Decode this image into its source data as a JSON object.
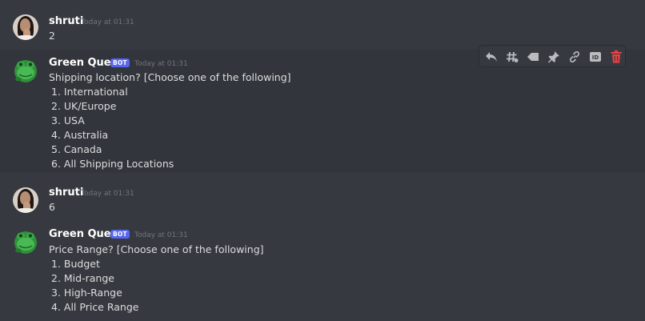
{
  "messages": [
    {
      "username": "shruti",
      "timestamp": "Today at 01:31",
      "lines": [
        "2"
      ]
    },
    {
      "username": "Green Queen",
      "badge": "BOT",
      "timestamp": "Today at 01:31",
      "lines": [
        "Shipping location? [Choose one of the following]",
        "1. International",
        "2. UK/Europe",
        "3. USA",
        "4. Australia",
        "5. Canada",
        "6. All Shipping Locations"
      ]
    },
    {
      "username": "shruti",
      "timestamp": "Today at 01:31",
      "lines": [
        "6"
      ]
    },
    {
      "username": "Green Queen",
      "badge": "BOT",
      "timestamp": "Today at 01:31",
      "lines": [
        "Price Range? [Choose one of the following]",
        "1. Budget",
        "2. Mid-range",
        "3. High-Range",
        "4. All Price Range"
      ]
    }
  ],
  "toolbar": {
    "icons": [
      "reply-icon",
      "create-thread-icon",
      "mark-unread-icon",
      "pin-icon",
      "copy-link-icon",
      "copy-id-icon",
      "delete-icon"
    ],
    "copy_id_label": "ID",
    "delete_color": "#ed4245"
  },
  "colors": {
    "background": "#36393f",
    "bot_badge": "#5865f2",
    "username": "#ffffff",
    "timestamp": "#72767d"
  }
}
